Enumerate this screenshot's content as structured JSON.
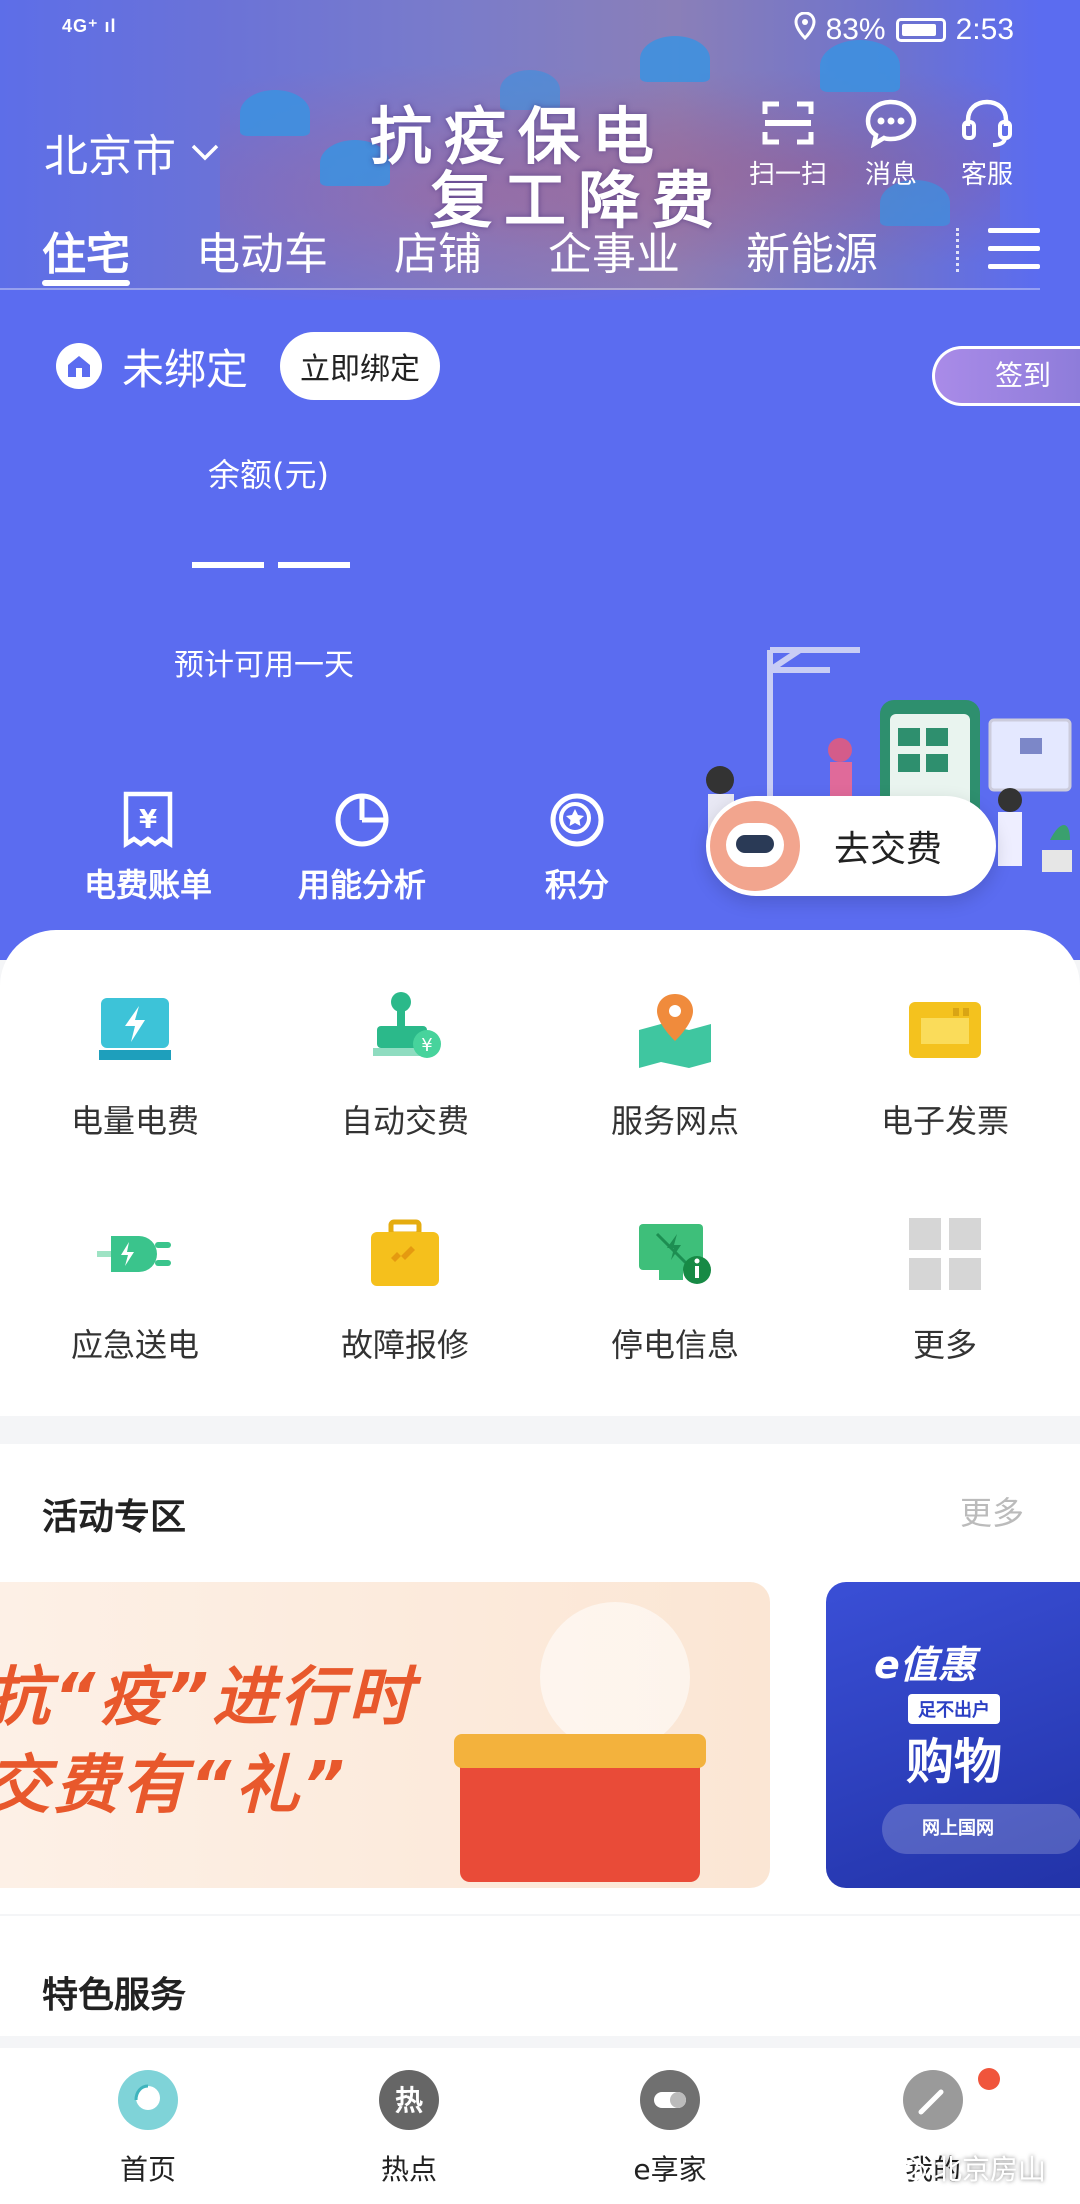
{
  "status_bar": {
    "network": "4G⁺ ıl",
    "battery_pct": "83%",
    "time": "2:53"
  },
  "header": {
    "city": "北京市",
    "banner_line1": "抗疫保电",
    "banner_line2": "复工降费",
    "actions": [
      {
        "label": "扫一扫",
        "icon": "scan-icon"
      },
      {
        "label": "消息",
        "icon": "message-icon"
      },
      {
        "label": "客服",
        "icon": "headset-icon"
      }
    ]
  },
  "tabs": [
    {
      "label": "住宅",
      "active": true
    },
    {
      "label": "电动车"
    },
    {
      "label": "店铺"
    },
    {
      "label": "企事业"
    },
    {
      "label": "新能源"
    }
  ],
  "account": {
    "bind_status": "未绑定",
    "bind_button": "立即绑定",
    "signin_button": "签到",
    "balance_label": "余额(元)",
    "estimate": "预计可用一天"
  },
  "quick_actions": [
    {
      "label": "电费账单",
      "icon": "bill-icon"
    },
    {
      "label": "用能分析",
      "icon": "pie-chart-icon"
    },
    {
      "label": "积分",
      "icon": "points-icon"
    }
  ],
  "pay_button": "去交费",
  "services": [
    {
      "label": "电量电费",
      "icon": "electricity-bill-icon"
    },
    {
      "label": "自动交费",
      "icon": "auto-pay-icon"
    },
    {
      "label": "服务网点",
      "icon": "map-pin-icon"
    },
    {
      "label": "电子发票",
      "icon": "invoice-card-icon"
    },
    {
      "label": "应急送电",
      "icon": "plug-icon"
    },
    {
      "label": "故障报修",
      "icon": "toolbox-icon"
    },
    {
      "label": "停电信息",
      "icon": "outage-info-icon"
    },
    {
      "label": "更多",
      "icon": "grid-more-icon"
    }
  ],
  "activity": {
    "title": "活动专区",
    "more": "更多",
    "banner1_line1": "抗“疫”进行时",
    "banner1_line2": "交费有“礼”",
    "banner2_title": "e值惠",
    "banner2_chip": "足不出户",
    "banner2_big": "购物",
    "banner2_foot": "网上国网"
  },
  "special": {
    "title": "特色服务"
  },
  "bottom_nav": [
    {
      "label": "首页",
      "icon": "home-nav-icon"
    },
    {
      "label": "热点",
      "icon": "hot-icon"
    },
    {
      "label": "e享家",
      "icon": "e-home-icon"
    },
    {
      "label": "我的",
      "icon": "profile-icon"
    }
  ],
  "watermark": "北京房山",
  "colors": {
    "primary": "#5b6cf0",
    "signin": "#9a84e0",
    "accent_red": "#e8582c"
  }
}
